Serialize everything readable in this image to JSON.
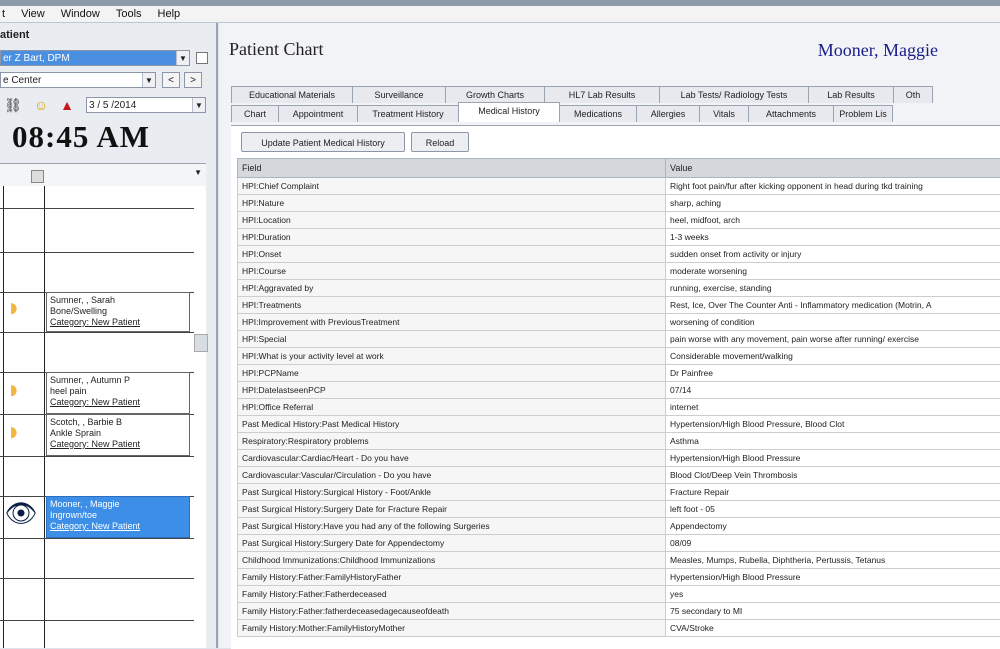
{
  "menu": {
    "items": [
      "t",
      "View",
      "Window",
      "Tools",
      "Help"
    ]
  },
  "left": {
    "section_title": "atient",
    "provider": "er Z Bart, DPM",
    "location": "e Center",
    "nav_prev": "<",
    "nav_next": ">",
    "date": "3 / 5 /2014",
    "clock": "08:45 AM",
    "appointments": [
      {
        "line1": "Sumner, , Sarah",
        "line2": "Bone/Swelling",
        "line3": "Category: New Patient"
      },
      {
        "line1": "Sumner, , Autumn P",
        "line2": "heel pain",
        "line3": "Category: New Patient"
      },
      {
        "line1": "Scotch, , Barbie B",
        "line2": "Ankle Sprain",
        "line3": "Category: New Patient"
      },
      {
        "line1": "Mooner, , Maggie",
        "line2": "Ingrown/toe",
        "line3": "Category: New Patient"
      }
    ],
    "colors": {
      "selected": "#3d8ee6",
      "appt_icon": "#f2b640"
    }
  },
  "main": {
    "title": "Patient Chart",
    "patient_name": "Mooner, Maggie",
    "tabs_row1": [
      "Educational Materials",
      "Surveillance",
      "Growth Charts",
      "HL7 Lab Results",
      "Lab Tests/ Radiology Tests",
      "Lab Results",
      "Oth"
    ],
    "tabs_row2": [
      "Chart",
      "Appointment",
      "Treatment History",
      "Medical History",
      "Medications",
      "Allergies",
      "Vitals",
      "Attachments",
      "Problem Lis"
    ],
    "active_tab": "Medical History",
    "btn_update": "Update Patient Medical History",
    "btn_reload": "Reload",
    "grid_headers": [
      "Field",
      "Value"
    ],
    "rows": [
      {
        "field": "HPI:Chief Complaint",
        "value": "Right foot pain/fur after kicking opponent in head during tkd training"
      },
      {
        "field": "HPI:Nature",
        "value": "sharp, aching"
      },
      {
        "field": "HPI:Location",
        "value": "heel, midfoot, arch"
      },
      {
        "field": "HPI:Duration",
        "value": "1-3 weeks"
      },
      {
        "field": "HPI:Onset",
        "value": "sudden onset from activity or injury"
      },
      {
        "field": "HPI:Course",
        "value": "moderate worsening"
      },
      {
        "field": "HPI:Aggravated by",
        "value": "running, exercise, standing"
      },
      {
        "field": "HPI:Treatments",
        "value": "Rest, Ice, Over The Counter Anti - Inflammatory medication (Motrin, A"
      },
      {
        "field": "HPI:Improvement with PreviousTreatment",
        "value": "worsening of condition"
      },
      {
        "field": "HPI:Special",
        "value": "pain worse with any movement, pain worse after running/ exercise"
      },
      {
        "field": "HPI:What is your activity level at work",
        "value": "Considerable movement/walking"
      },
      {
        "field": "HPI:PCPName",
        "value": "Dr Painfree"
      },
      {
        "field": "HPI:DatelastseenPCP",
        "value": "07/14"
      },
      {
        "field": "HPI:Office Referral",
        "value": "internet"
      },
      {
        "field": "Past Medical History:Past Medical History",
        "value": "Hypertension/High Blood Pressure, Blood Clot"
      },
      {
        "field": "Respiratory:Respiratory problems",
        "value": "Asthma"
      },
      {
        "field": "Cardiovascular:Cardiac/Heart - Do you have",
        "value": "Hypertension/High Blood Pressure"
      },
      {
        "field": "Cardiovascular:Vascular/Circulation - Do you have",
        "value": "Blood Clot/Deep Vein Thrombosis"
      },
      {
        "field": "Past Surgical History:Surgical History - Foot/Ankle",
        "value": "Fracture Repair"
      },
      {
        "field": "Past Surgical History:Surgery Date for Fracture Repair",
        "value": "left foot - 05"
      },
      {
        "field": "Past Surgical History:Have you had any of the following Surgeries",
        "value": "Appendectomy"
      },
      {
        "field": "Past Surgical History:Surgery Date for Appendectomy",
        "value": "08/09"
      },
      {
        "field": "Childhood Immunizations:Childhood Immunizations",
        "value": "Measles, Mumps, Rubella, Diphtheria, Pertussis, Tetanus"
      },
      {
        "field": "Family History:Father:FamilyHistoryFather",
        "value": "Hypertension/High Blood Pressure"
      },
      {
        "field": "Family History:Father:Fatherdeceased",
        "value": "yes"
      },
      {
        "field": "Family History:Father:fatherdeceasedagecauseofdeath",
        "value": "75 secondary to MI"
      },
      {
        "field": "Family History:Mother:FamilyHistoryMother",
        "value": "CVA/Stroke"
      }
    ]
  }
}
